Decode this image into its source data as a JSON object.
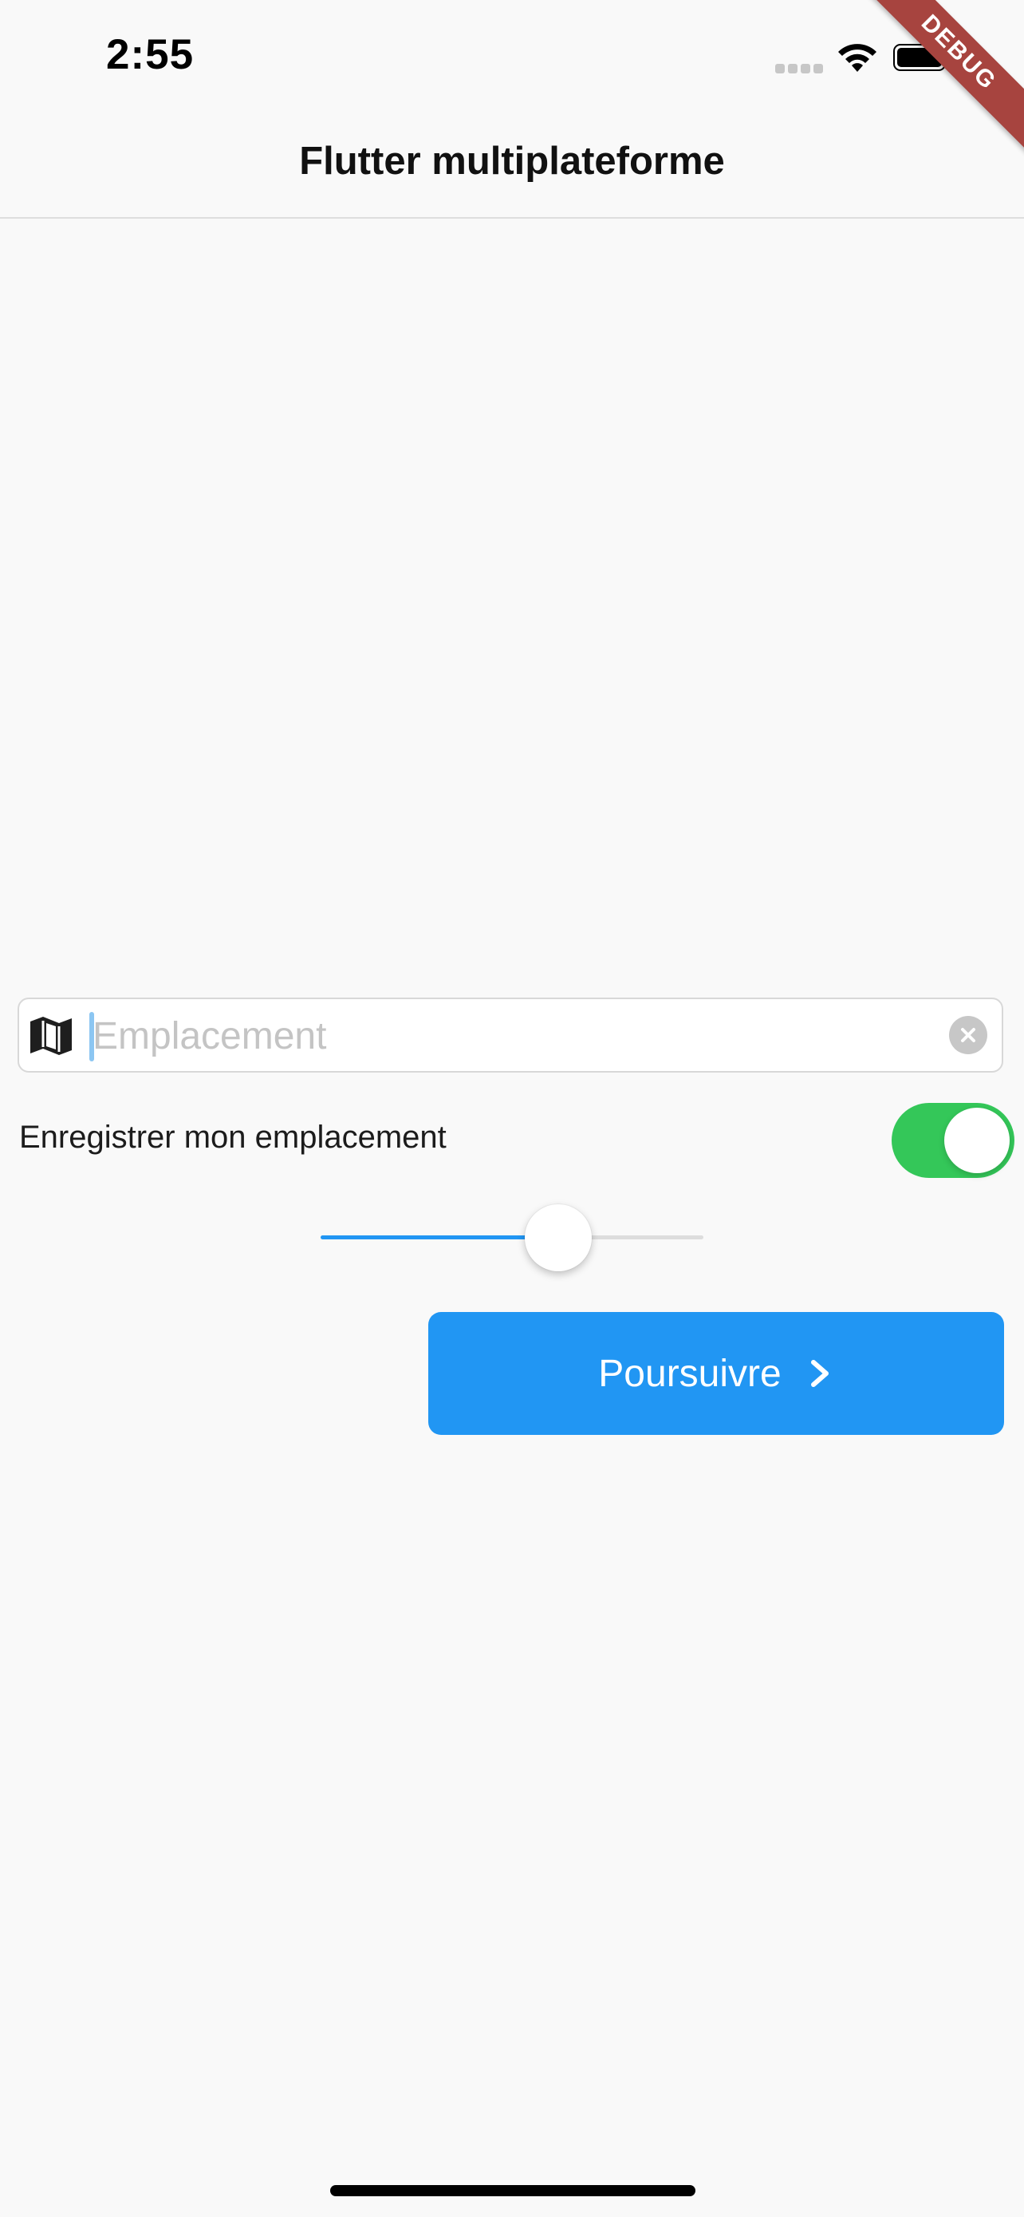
{
  "status_bar": {
    "time": "2:55"
  },
  "debug_banner": {
    "label": "DEBUG",
    "color": "#a7443f"
  },
  "nav": {
    "title": "Flutter multiplateforme"
  },
  "location": {
    "placeholder": "Emplacement",
    "value": "",
    "leading_icon": "map-icon",
    "trailing_icon": "clear-icon"
  },
  "save_location": {
    "label": "Enregistrer mon emplacement",
    "enabled": true,
    "toggle_color": "#34c759"
  },
  "slider": {
    "value": 0.62,
    "active_color": "#2196f3"
  },
  "continue_button": {
    "label": "Poursuivre",
    "icon": "chevron-right-icon",
    "color": "#2196f3"
  }
}
